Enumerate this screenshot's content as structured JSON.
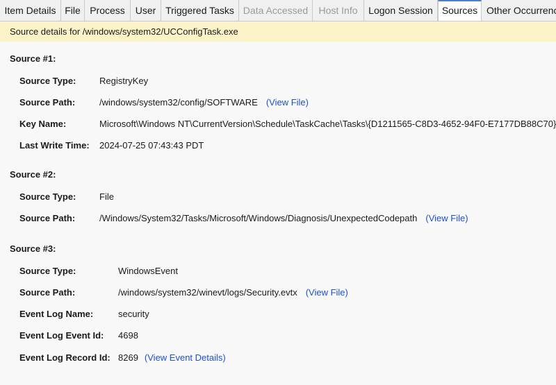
{
  "tabs": [
    {
      "label": "Item Details",
      "state": "normal"
    },
    {
      "label": "File",
      "state": "normal"
    },
    {
      "label": "Process",
      "state": "normal"
    },
    {
      "label": "User",
      "state": "normal"
    },
    {
      "label": "Triggered Tasks",
      "state": "normal"
    },
    {
      "label": "Data Accessed",
      "state": "disabled"
    },
    {
      "label": "Host Info",
      "state": "disabled"
    },
    {
      "label": "Logon Session",
      "state": "normal"
    },
    {
      "label": "Sources",
      "state": "active"
    },
    {
      "label": "Other Occurrences",
      "state": "normal"
    }
  ],
  "banner": {
    "text": "Source details for /windows/system32/UCConfigTask.exe"
  },
  "sources": [
    {
      "title": "Source #1:",
      "rows": [
        {
          "label": "Source Type:",
          "value": "RegistryKey"
        },
        {
          "label": "Source Path:",
          "value": "/windows/system32/config/SOFTWARE",
          "link": "(View File)"
        },
        {
          "label": "Key Name:",
          "value": "Microsoft\\Windows NT\\CurrentVersion\\Schedule\\TaskCache\\Tasks\\{D1211565-C8D3-4652-94F0-E7177DB88C70}"
        },
        {
          "label": "Last Write Time:",
          "value": "2024-07-25 07:43:43 PDT"
        }
      ]
    },
    {
      "title": "Source #2:",
      "rows": [
        {
          "label": "Source Type:",
          "value": "File"
        },
        {
          "label": "Source Path:",
          "value": "/Windows/System32/Tasks/Microsoft/Windows/Diagnosis/UnexpectedCodepath",
          "link": "(View File)"
        }
      ]
    },
    {
      "title": "Source #3:",
      "rows": [
        {
          "label": "Source Type:",
          "value": "WindowsEvent"
        },
        {
          "label": "Source Path:",
          "value": "/windows/system32/winevt/logs/Security.evtx",
          "link": "(View File)"
        },
        {
          "label": "Event Log Name:",
          "value": "security"
        },
        {
          "label": "Event Log Event Id:",
          "value": "4698"
        },
        {
          "label": "Event Log Record Id:",
          "value": "8269",
          "link": "(View Event Details)"
        }
      ]
    }
  ],
  "colors": {
    "banner_bg": "#fdf3c9",
    "link": "#1a4fd6",
    "active_tab_accent": "#4a7fd1"
  }
}
